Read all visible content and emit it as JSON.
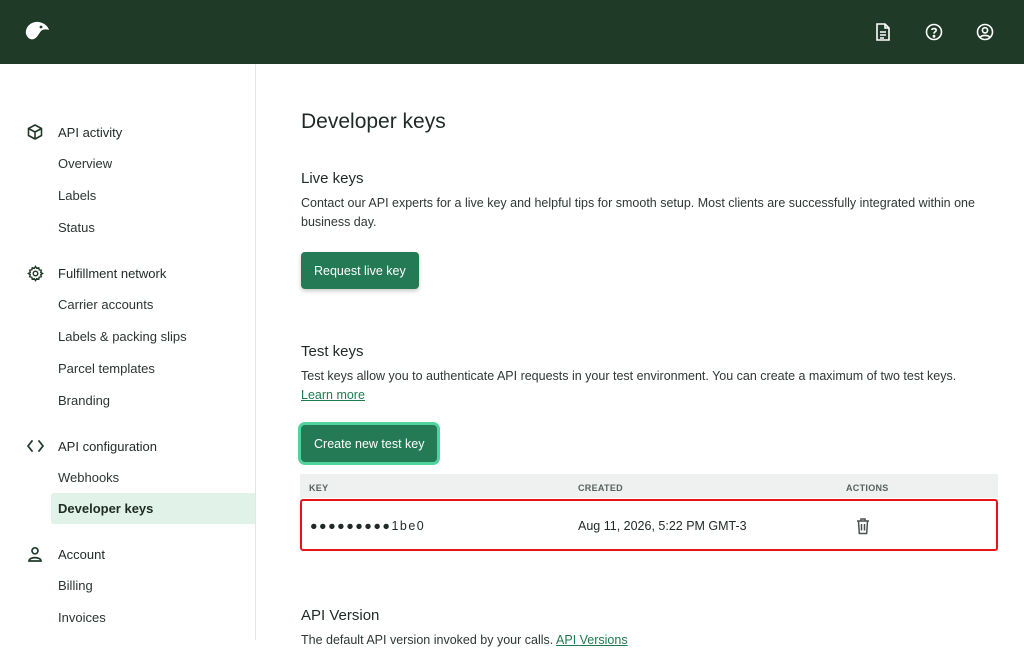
{
  "header": {
    "logo_icon": "bird-logo-icon",
    "icons": [
      "document-icon",
      "help-circle-icon",
      "user-circle-icon"
    ],
    "color": "#1f3a27"
  },
  "sidebar": {
    "sections": [
      {
        "label": "API activity",
        "icon": "box-icon",
        "items": [
          "Overview",
          "Labels",
          "Status"
        ]
      },
      {
        "label": "Fulfillment network",
        "icon": "gear-icon",
        "items": [
          "Carrier accounts",
          "Labels & packing slips",
          "Parcel templates",
          "Branding"
        ]
      },
      {
        "label": "API configuration",
        "icon": "code-icon",
        "items": [
          "Webhooks",
          "Developer keys"
        ]
      },
      {
        "label": "Account",
        "icon": "person-icon",
        "items": [
          "Billing",
          "Invoices"
        ]
      }
    ],
    "active_item": "Developer keys"
  },
  "main": {
    "title": "Developer keys",
    "live": {
      "heading": "Live keys",
      "description": "Contact our API experts for a live key and helpful tips for smooth setup. Most clients are successfully integrated within one business day.",
      "button": "Request live key"
    },
    "test": {
      "heading": "Test keys",
      "description": "Test keys allow you to authenticate API requests in your test environment. You can create a maximum of two test keys.",
      "learn_more": "Learn more",
      "button": "Create new test key"
    },
    "table": {
      "columns": [
        "KEY",
        "CREATED",
        "ACTIONS"
      ],
      "rows": [
        {
          "key": "●●●●●●●●●1be0",
          "created": "Aug 11, 2026, 5:22 PM GMT-3",
          "action_icon": "trash-icon"
        }
      ]
    },
    "api_version": {
      "heading": "API Version",
      "description": "The default API version invoked by your calls.",
      "link": "API Versions"
    }
  },
  "colors": {
    "accent": "#247a54",
    "highlight": "#e8141c",
    "active_bg": "#e1f3e8"
  }
}
